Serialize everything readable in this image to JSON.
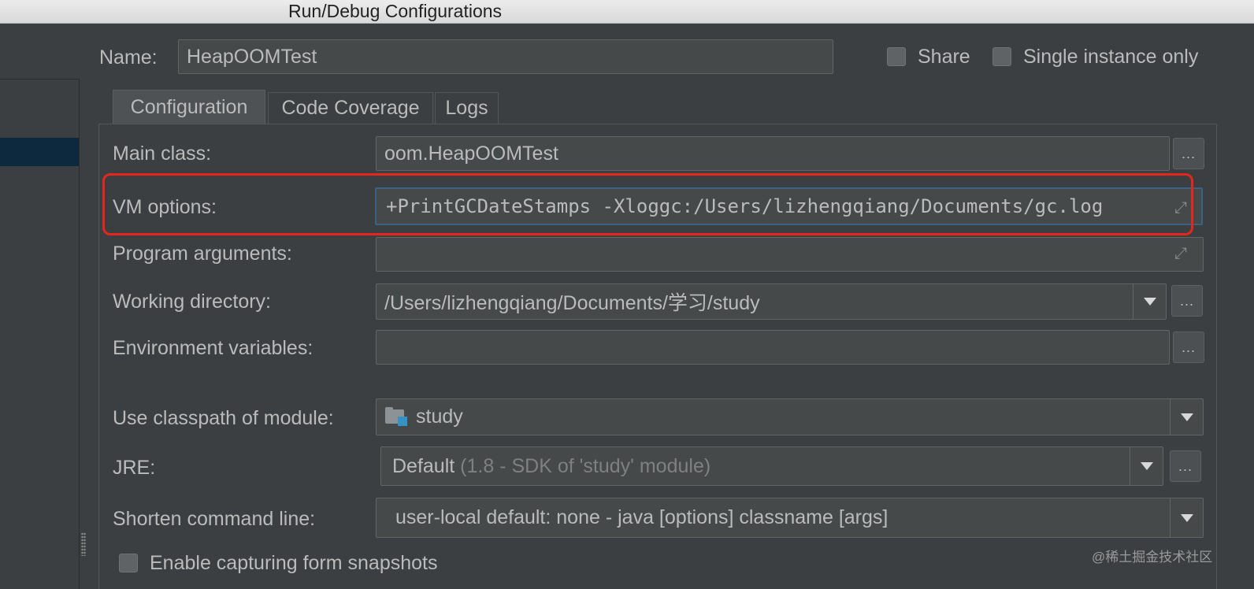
{
  "window": {
    "title": "Run/Debug Configurations"
  },
  "name_row": {
    "label": "Name:",
    "value": "HeapOOMTest",
    "share_label": "Share",
    "single_instance_label": "Single instance only"
  },
  "tabs": [
    {
      "label": "Configuration",
      "active": true
    },
    {
      "label": "Code Coverage",
      "active": false
    },
    {
      "label": "Logs",
      "active": false
    }
  ],
  "config": {
    "main_class": {
      "label": "Main class:",
      "value": "oom.HeapOOMTest",
      "button": "..."
    },
    "vm_options": {
      "label": "VM options:",
      "value": "+PrintGCDateStamps -Xloggc:/Users/lizhengqiang/Documents/gc.log"
    },
    "program_arguments": {
      "label": "Program arguments:",
      "value": ""
    },
    "working_directory": {
      "label": "Working directory:",
      "value": "/Users/lizhengqiang/Documents/学习/study",
      "button": "..."
    },
    "environment_variables": {
      "label": "Environment variables:",
      "value": "",
      "button": "..."
    },
    "classpath_module": {
      "label": "Use classpath of module:",
      "value": "study"
    },
    "jre": {
      "label": "JRE:",
      "value": "Default",
      "hint": "(1.8 - SDK of 'study' module)",
      "button": "..."
    },
    "shorten_command_line": {
      "label": "Shorten command line:",
      "value": "user-local default: none",
      "hint": "- java [options] classname [args]"
    },
    "capture_snapshots": {
      "label": "Enable capturing form snapshots"
    }
  },
  "watermark": "@稀土掘金技术社区",
  "colors": {
    "highlight": "#e5261d",
    "focus": "#3d6185",
    "selection": "#0d293e"
  }
}
